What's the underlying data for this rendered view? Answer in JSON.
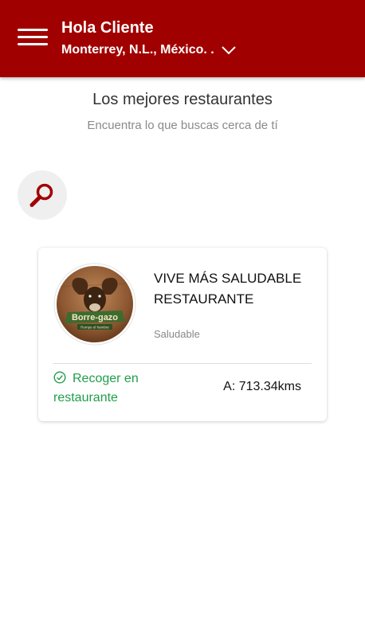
{
  "header": {
    "greeting": "Hola Cliente",
    "location": "Monterrey, N.L., México. .",
    "background_color": "#a10000",
    "icons": [
      "menu-icon",
      "chevron-down-icon"
    ]
  },
  "main": {
    "title": "Los mejores restaurantes",
    "subtitle": "Encuentra lo que buscas cerca de tí",
    "search_icon": "search-icon"
  },
  "restaurants": [
    {
      "name": "VIVE MÁS SALUDABLE RESTAURANTE",
      "category": "Saludable",
      "pickup_label": "Recoger en restaurante",
      "distance": "A: 713.34kms",
      "logo": {
        "brand_text": "Borre-gazo",
        "tagline": "Rompe el hambre"
      }
    }
  ],
  "colors": {
    "brand": "#a10000",
    "pickup_green": "#1e9e4a"
  }
}
